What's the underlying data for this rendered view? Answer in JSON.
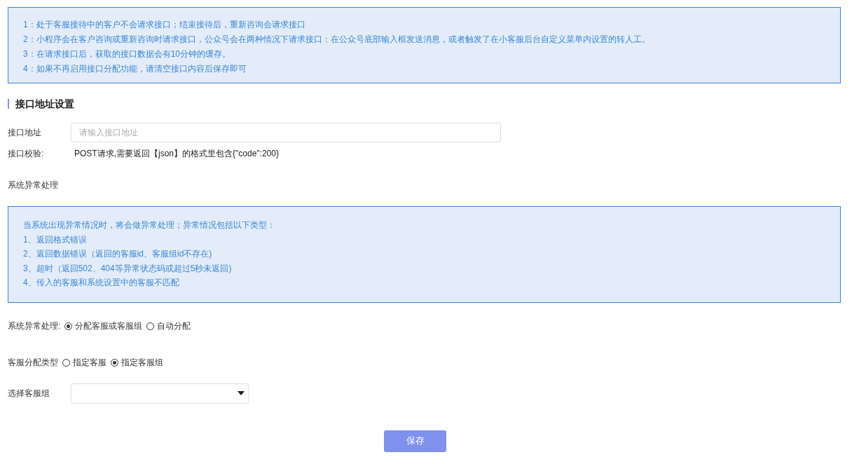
{
  "notice": {
    "lines": [
      "1：处于客服接待中的客户不会请求接口；结束接待后，重新咨询会请求接口",
      "2：小程序会在客户咨询或重新咨询时请求接口，公众号会在两种情况下请求接口：在公众号底部输入框发送消息，或者触发了在小客服后台自定义菜单内设置的转人工。",
      "3：在请求接口后，获取的接口数据会有10分钟的缓存。",
      "4：如果不再启用接口分配功能，请清空接口内容后保存即可"
    ]
  },
  "section_title": "接口地址设置",
  "address": {
    "label": "接口地址",
    "placeholder": "请输入接口地址"
  },
  "verify": {
    "label": "接口校验:",
    "text": "POST请求,需要返回【json】的格式里包含{\"code\":200}"
  },
  "exception_title": "系统异常处理",
  "exception_notice": {
    "lines": [
      "当系统出现异常情况时，将会做异常处理；异常情况包括以下类型：",
      "1、返回格式错误",
      "2、返回数据错误（返回的客服id、客服组id不存在)",
      "3、超时（返回502、404等异常状态码或超过5秒未返回)",
      "4、传入的客服和系统设置中的客服不匹配"
    ]
  },
  "radio_groups": [
    {
      "label": "系统异常处理:",
      "options": [
        {
          "label": "分配客服或客服组",
          "selected": true
        },
        {
          "label": "自动分配",
          "selected": false
        }
      ]
    },
    {
      "label": "客服分配类型",
      "options": [
        {
          "label": "指定客服",
          "selected": false
        },
        {
          "label": "指定客服组",
          "selected": true
        }
      ]
    }
  ],
  "group_select": {
    "label": "选择客服组"
  },
  "save_button": "保存"
}
